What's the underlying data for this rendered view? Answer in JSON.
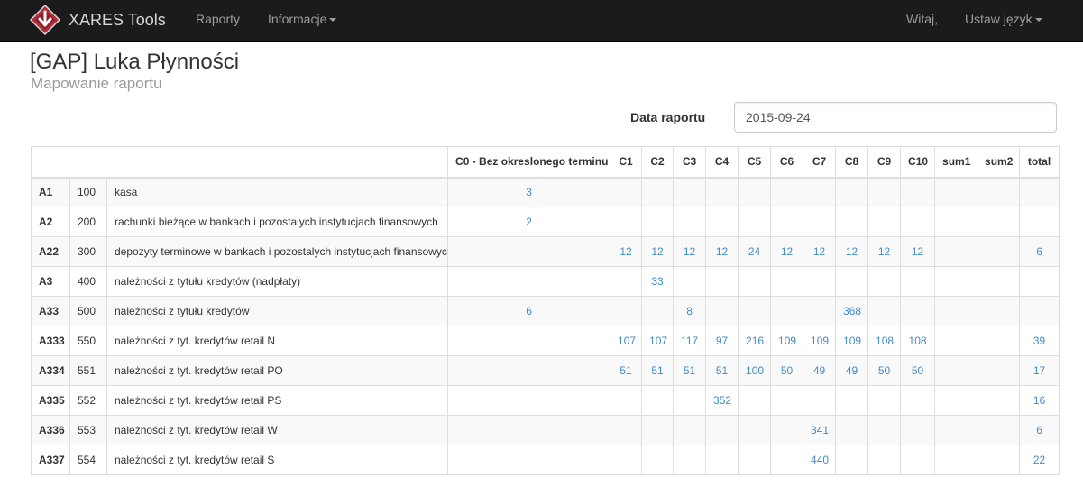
{
  "navbar": {
    "brand": "XARES Tools",
    "links": [
      {
        "label": "Raporty",
        "dropdown": false
      },
      {
        "label": "Informacje",
        "dropdown": true
      }
    ],
    "greeting": "Witaj,",
    "language": "Ustaw język"
  },
  "page": {
    "title": "[GAP] Luka Płynności",
    "subtitle": "Mapowanie raportu"
  },
  "form": {
    "date_label": "Data raportu",
    "date_value": "2015-09-24"
  },
  "table": {
    "headers": [
      "",
      "C0 - Bez okreslonego terminu",
      "C1",
      "C2",
      "C3",
      "C4",
      "C5",
      "C6",
      "C7",
      "C8",
      "C9",
      "C10",
      "sum1",
      "sum2",
      "total"
    ],
    "rows": [
      {
        "code": "A1",
        "num": "100",
        "name": "kasa",
        "values": [
          "3",
          "",
          "",
          "",
          "",
          "",
          "",
          "",
          "",
          "",
          "",
          "",
          "",
          ""
        ]
      },
      {
        "code": "A2",
        "num": "200",
        "name": "rachunki bieżące w bankach i pozostalych instytucjach finansowych",
        "values": [
          "2",
          "",
          "",
          "",
          "",
          "",
          "",
          "",
          "",
          "",
          "",
          "",
          "",
          ""
        ]
      },
      {
        "code": "A22",
        "num": "300",
        "name": "depozyty terminowe w bankach i pozostalych instytucjach finansowych",
        "values": [
          "",
          "12",
          "12",
          "12",
          "12",
          "24",
          "12",
          "12",
          "12",
          "12",
          "12",
          "",
          "",
          "6"
        ]
      },
      {
        "code": "A3",
        "num": "400",
        "name": "należności z tytułu kredytów (nadpłaty)",
        "values": [
          "",
          "",
          "33",
          "",
          "",
          "",
          "",
          "",
          "",
          "",
          "",
          "",
          "",
          ""
        ]
      },
      {
        "code": "A33",
        "num": "500",
        "name": "należności z tytułu kredytów",
        "values": [
          "6",
          "",
          "",
          "8",
          "",
          "",
          "",
          "",
          "368",
          "",
          "",
          "",
          "",
          ""
        ]
      },
      {
        "code": "A333",
        "num": "550",
        "name": "należności z tyt. kredytów retail N",
        "values": [
          "",
          "107",
          "107",
          "117",
          "97",
          "216",
          "109",
          "109",
          "109",
          "108",
          "108",
          "",
          "",
          "39"
        ]
      },
      {
        "code": "A334",
        "num": "551",
        "name": "należności z tyt. kredytów retail PO",
        "values": [
          "",
          "51",
          "51",
          "51",
          "51",
          "100",
          "50",
          "49",
          "49",
          "50",
          "50",
          "",
          "",
          "17"
        ]
      },
      {
        "code": "A335",
        "num": "552",
        "name": "należności z tyt. kredytów retail PS",
        "values": [
          "",
          "",
          "",
          "",
          "352",
          "",
          "",
          "",
          "",
          "",
          "",
          "",
          "",
          "16"
        ]
      },
      {
        "code": "A336",
        "num": "553",
        "name": "należności z tyt. kredytów retail W",
        "values": [
          "",
          "",
          "",
          "",
          "",
          "",
          "",
          "341",
          "",
          "",
          "",
          "",
          "",
          "6"
        ]
      },
      {
        "code": "A337",
        "num": "554",
        "name": "należności z tyt. kredytów retail S",
        "values": [
          "",
          "",
          "",
          "",
          "",
          "",
          "",
          "440",
          "",
          "",
          "",
          "",
          "",
          "22"
        ]
      }
    ]
  }
}
